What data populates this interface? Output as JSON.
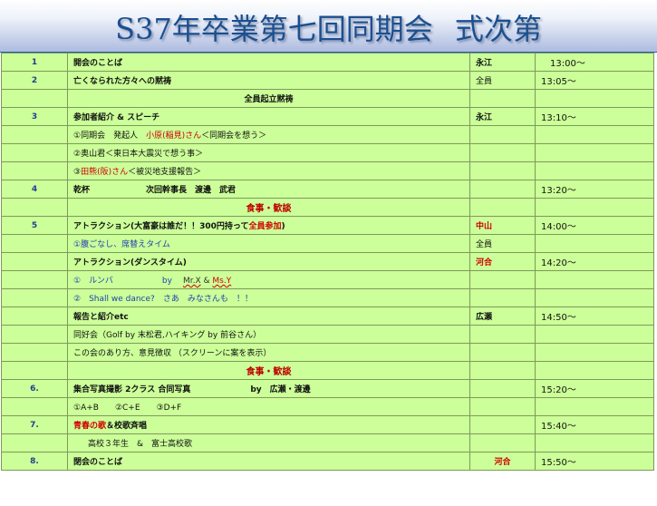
{
  "title": {
    "part1": "S37年卒業第七回同期会",
    "part2": "式次第"
  },
  "rows": {
    "r1": {
      "no": "1",
      "item": "開会のことば",
      "person": "永江",
      "time": "13:00〜"
    },
    "r2": {
      "no": "2",
      "item": "亡くなられた方々への黙祷",
      "person": "全員",
      "time": "13:05〜"
    },
    "r2b": {
      "item": "全員起立黙祷"
    },
    "r3": {
      "no": "3",
      "item": "参加者紹介 & スピーチ",
      "person": "永江",
      "time": "13:10〜"
    },
    "r3a": {
      "pre": "①同期会　発起人　",
      "red": "小原(稲見)さん",
      "post": "＜同期会を想う＞"
    },
    "r3b": {
      "text": "②奥山君＜東日本大震災で想う事＞"
    },
    "r3c": {
      "pre": "③",
      "red": "田熊(阪)さん",
      "post": "＜被災地支援報告＞"
    },
    "r4": {
      "no": "4",
      "item": "乾杯",
      "role": "次回幹事長　渡邊　武君",
      "time": "13:20〜"
    },
    "meal1": {
      "text": "食事・歓談"
    },
    "r5": {
      "no": "5",
      "pre": "アトラクション(大富豪は誰だ！！300円持って",
      "red": "全員参加",
      "post": ")",
      "person": "中山",
      "time": "14:00〜"
    },
    "r5a": {
      "text": "①腹ごなし、席替えタイム",
      "person": "全員"
    },
    "r5b": {
      "item": "アトラクション(ダンスタイム)",
      "person": "河合",
      "time": "14:20〜"
    },
    "r5c": {
      "pre": "①　ルンバ",
      "by": "by",
      "mrx": "Mr.X",
      "amp": "&",
      "msy": "Ms.Y"
    },
    "r5d": {
      "text": "②　Shall we dance?　さあ　みなさんも　！！"
    },
    "r5e": {
      "item": "報告と紹介etc",
      "person": "広瀬",
      "time": "14:50〜"
    },
    "r5f": {
      "text": "同好会（Golf by 末松君,ハイキング by 前谷さん）"
    },
    "r5g": {
      "text": "この会のあり方、意見徴収 （スクリーンに案を表示）"
    },
    "meal2": {
      "text": "食事・歓談"
    },
    "r6": {
      "no": "6.",
      "item": "集合写真撮影  2クラス  合同写真",
      "by": "by　広瀬・渡邊",
      "time": "15:20〜"
    },
    "r6a": {
      "text": "①A+B　　②C+E　　③D+F"
    },
    "r7": {
      "no": "7.",
      "red": "青春の歌",
      "post": "＆校歌斉唱",
      "time": "15:40〜"
    },
    "r7a": {
      "text": "高校３年生　&　富士高校歌"
    },
    "r8": {
      "no": "8.",
      "item": "閉会のことば",
      "person": "河合",
      "time": "15:50〜"
    }
  },
  "colors": {
    "background": "#ccff99",
    "grey_cell": "#e4e4de",
    "title": "#1b4f8f",
    "accent_red": "#d00000"
  }
}
